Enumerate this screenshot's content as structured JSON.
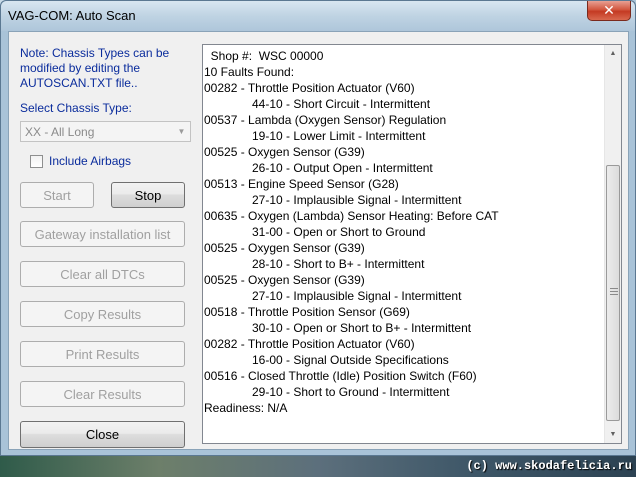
{
  "window": {
    "title": "VAG-COM: Auto Scan",
    "close_glyph": "✕"
  },
  "left_panel": {
    "note_line1": "Note:  Chassis Types can be",
    "note_line2": "modified by editing the",
    "note_line3": "AUTOSCAN.TXT file..",
    "select_label": "Select Chassis Type:",
    "chassis_value": "XX - All Long",
    "include_airbags_label": "Include Airbags",
    "include_airbags_checked": false
  },
  "buttons": {
    "start": "Start",
    "stop": "Stop",
    "gateway": "Gateway installation list",
    "clear_dtcs": "Clear all DTCs",
    "copy_results": "Copy Results",
    "print_results": "Print Results",
    "clear_results": "Clear Results",
    "close": "Close"
  },
  "results": {
    "lines": [
      {
        "text": "  Shop #:  WSC 00000",
        "indent": false
      },
      {
        "text": "10 Faults Found:",
        "indent": false
      },
      {
        "text": "00282 - Throttle Position Actuator (V60)",
        "indent": false
      },
      {
        "text": "44-10 - Short Circuit - Intermittent",
        "indent": true
      },
      {
        "text": "00537 - Lambda (Oxygen Sensor) Regulation",
        "indent": false
      },
      {
        "text": "19-10 - Lower Limit - Intermittent",
        "indent": true
      },
      {
        "text": "00525 - Oxygen Sensor (G39)",
        "indent": false
      },
      {
        "text": "26-10 - Output Open - Intermittent",
        "indent": true
      },
      {
        "text": "00513 - Engine Speed Sensor (G28)",
        "indent": false
      },
      {
        "text": "27-10 - Implausible Signal - Intermittent",
        "indent": true
      },
      {
        "text": "00635 - Oxygen (Lambda) Sensor Heating: Before CAT",
        "indent": false
      },
      {
        "text": "31-00 - Open or Short to Ground",
        "indent": true
      },
      {
        "text": "00525 - Oxygen Sensor (G39)",
        "indent": false
      },
      {
        "text": "28-10 - Short to B+ - Intermittent",
        "indent": true
      },
      {
        "text": "00525 - Oxygen Sensor (G39)",
        "indent": false
      },
      {
        "text": "27-10 - Implausible Signal - Intermittent",
        "indent": true
      },
      {
        "text": "00518 - Throttle Position Sensor (G69)",
        "indent": false
      },
      {
        "text": "30-10 - Open or Short to B+ - Intermittent",
        "indent": true
      },
      {
        "text": "00282 - Throttle Position Actuator (V60)",
        "indent": false
      },
      {
        "text": "16-00 - Signal Outside Specifications",
        "indent": true
      },
      {
        "text": "00516 - Closed Throttle (Idle) Position Switch (F60)",
        "indent": false
      },
      {
        "text": "29-10 - Short to Ground - Intermittent",
        "indent": true
      },
      {
        "text": "Readiness: N/A",
        "indent": false
      }
    ]
  },
  "watermark": "(c) www.skodafelicia.ru",
  "icons": {
    "combo_arrow": "chevron-down-icon",
    "scroll_up": "scroll-up-arrow-icon",
    "scroll_down": "scroll-down-arrow-icon",
    "close": "close-icon"
  },
  "colors": {
    "label_blue": "#0a2c9c",
    "close_red": "#c43a23",
    "disabled_text": "#a0a0a0"
  }
}
